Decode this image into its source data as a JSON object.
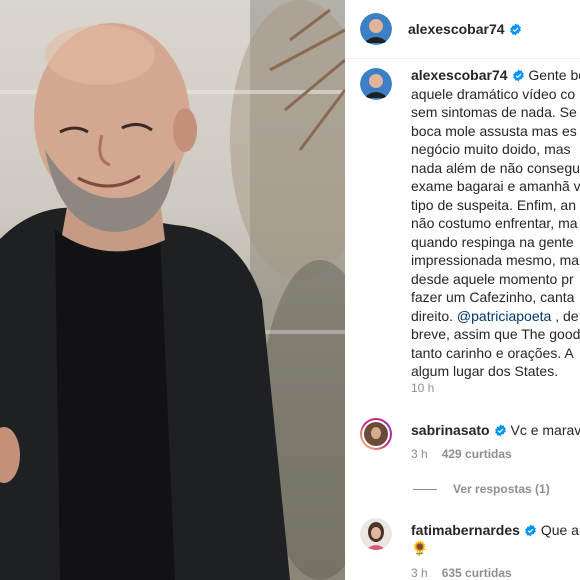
{
  "post": {
    "username": "alexescobar74",
    "caption_lines": [
      "Gente bo",
      "aquele dramático vídeo co",
      "sem sintomas de nada. Se",
      "boca mole assusta mas es",
      "negócio muito doido, mas",
      "nada além de não consegu",
      "exame bagarai e amanhã v",
      "tipo de suspeita. Enfim, an",
      "não costumo enfrentar, ma",
      "quando respinga na gente",
      "impressionada mesmo, ma",
      "desde aquele momento pr",
      "fazer um Cafezinho, canta",
      "direito.",
      "@patriciapoeta",
      ", de",
      "breve, assim que The good",
      "tanto carinho e orações. A",
      "algum lugar dos States."
    ],
    "time": "10 h"
  },
  "comments": [
    {
      "username": "sabrinasato",
      "text": "Vc e marav",
      "time": "3 h",
      "likes": "429 curtidas"
    },
    {
      "username": "fatimabernardes",
      "text": "Que al",
      "emoji": "🌻",
      "time": "3 h",
      "likes": "635 curtidas"
    }
  ],
  "replies_label": "Ver respostas (1)",
  "colors": {
    "verified": "#0095f6",
    "mention": "#00376b",
    "muted": "#8e8e8e"
  }
}
